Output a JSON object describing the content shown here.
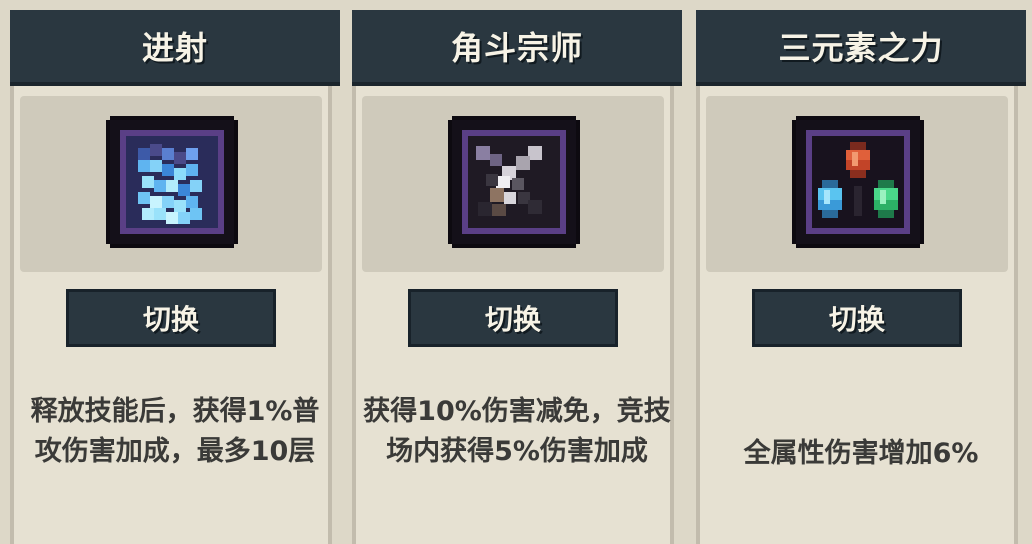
{
  "cards": [
    {
      "title": "进射",
      "icon": "arrow-shot-icon",
      "button_label": "切换",
      "description": "释放技能后，获得1%普攻伤害加成，最多10层"
    },
    {
      "title": "角斗宗师",
      "icon": "crossed-swords-icon",
      "button_label": "切换",
      "description": "获得10%伤害减免，竞技场内获得5%伤害加成"
    },
    {
      "title": "三元素之力",
      "icon": "three-crystals-icon",
      "button_label": "切换",
      "description": "全属性伤害增加6%"
    }
  ]
}
